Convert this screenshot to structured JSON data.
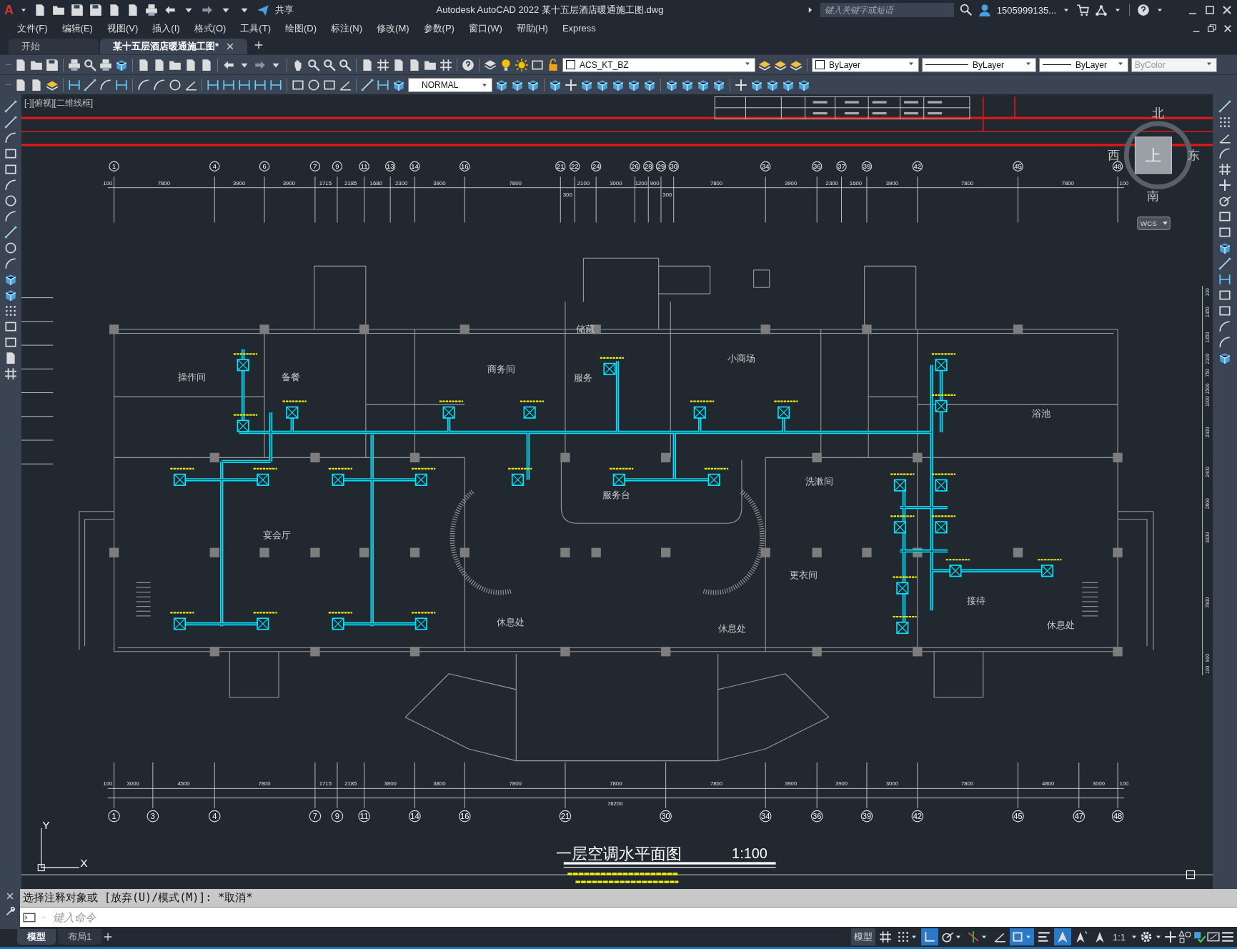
{
  "title_bar": {
    "logo": "A",
    "share": "共享",
    "title": "Autodesk AutoCAD 2022    某十五层酒店暖通施工图.dwg",
    "search": {
      "placeholder": "键入关键字或短语"
    },
    "user": "1505999135..."
  },
  "menu": [
    "文件(F)",
    "编辑(E)",
    "视图(V)",
    "插入(I)",
    "格式(O)",
    "工具(T)",
    "绘图(D)",
    "标注(N)",
    "修改(M)",
    "参数(P)",
    "窗口(W)",
    "帮助(H)",
    "Express"
  ],
  "tabs": [
    {
      "label": "开始",
      "selected": false
    },
    {
      "label": "某十五层酒店暖通施工图*",
      "selected": true
    }
  ],
  "toolbar": {
    "layer": "ACS_KT_BZ",
    "color_control": "ByLayer",
    "linetype": "ByLayer",
    "lineweight": "ByLayer",
    "plot_style": {
      "value": "ByColor",
      "disabled": true
    },
    "text_style": "NORMAL"
  },
  "viewport": {
    "label": "[-][俯视][二维线框]",
    "compass": {
      "north": "北",
      "south": "南",
      "east": "东",
      "west": "西",
      "face": "上"
    },
    "ucs_menu": "WCS",
    "ucs_y": "Y",
    "ucs_x": "X"
  },
  "drawing": {
    "top_axes": [
      "1",
      "4",
      "6",
      "7",
      "9",
      "11",
      "13",
      "14",
      "16",
      "21",
      "22",
      "24",
      "26",
      "28",
      "29",
      "30",
      "34",
      "36",
      "37",
      "39",
      "42",
      "45",
      "48"
    ],
    "top_dimensions": [
      "100",
      "7800",
      "3900",
      "3900",
      "1715",
      "2185",
      "1680",
      "2300",
      "3900",
      "7800",
      "300",
      "2100",
      "3000",
      "1200",
      "900",
      "300",
      "7800",
      "3900",
      "2300",
      "1600",
      "3900",
      "7800",
      "7800",
      "100"
    ],
    "bottom_axes": [
      "1",
      "3",
      "4",
      "7",
      "9",
      "11",
      "14",
      "16",
      "21",
      "30",
      "34",
      "36",
      "39",
      "42",
      "45",
      "47",
      "48"
    ],
    "bottom_dimensions": [
      "100",
      "3000",
      "4500",
      "7800",
      "1715",
      "2185",
      "3800",
      "3800",
      "7800",
      "7800",
      "7800",
      "3900",
      "3900",
      "3000",
      "7800",
      "4800",
      "3000",
      "100"
    ],
    "bottom_total": "78200",
    "side_dimensions": [
      "100",
      "1350",
      "1350",
      "2100",
      "750",
      "1500",
      "1000",
      "2300",
      "2400",
      "2600",
      "3300",
      "7800",
      "900",
      "100"
    ],
    "rooms": [
      "操作间",
      "备餐",
      "商务间",
      "储藏",
      "服务",
      "小商场",
      "浴池",
      "宴会厅",
      "服务台",
      "洗漱间",
      "更衣间",
      "接待",
      "休息处",
      "休息处",
      "休息处"
    ],
    "title": "一层空调水平面图",
    "scale": "1:100"
  },
  "command_line": {
    "history": "选择注释对象或 [放弃(U)/模式(M)]: *取消*",
    "placeholder": "键入命令"
  },
  "layout_tabs": [
    {
      "label": "模型",
      "selected": true
    },
    {
      "label": "布局1",
      "selected": false
    }
  ],
  "status_bar": {
    "space": "模型",
    "scale": "1:1",
    "toggles": [
      {
        "kind": "grid",
        "on": false,
        "menu": false
      },
      {
        "kind": "snap",
        "on": false,
        "menu": true
      },
      {
        "kind": "ortho",
        "on": true,
        "menu": false
      },
      {
        "kind": "polar",
        "on": false,
        "menu": true
      },
      {
        "kind": "tracking",
        "on": false,
        "menu": true
      },
      {
        "kind": "angle",
        "on": false,
        "menu": false
      },
      {
        "kind": "osnap",
        "on": true,
        "menu": true
      },
      {
        "kind": "lineweight",
        "on": false,
        "menu": false
      },
      {
        "kind": "annotation",
        "on": true,
        "menu": false
      },
      {
        "kind": "autoscale",
        "on": false,
        "menu": false
      },
      {
        "kind": "annoscale",
        "on": false,
        "menu": false
      }
    ]
  }
}
